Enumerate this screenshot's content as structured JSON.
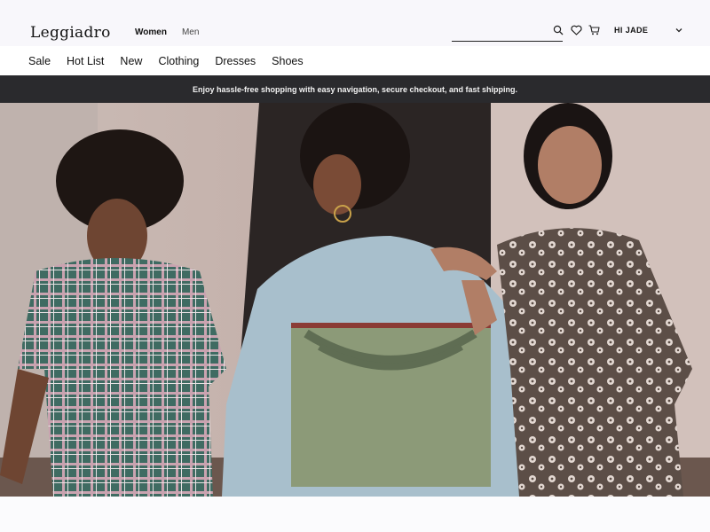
{
  "header": {
    "logo": "Leggiadro",
    "nav": {
      "women": "Women",
      "men": "Men"
    },
    "search": {
      "placeholder": ""
    },
    "account": {
      "label": "HI JADE"
    },
    "icons": [
      "search-icon",
      "heart-icon",
      "cart-icon",
      "chevron-down-icon"
    ]
  },
  "categories": [
    "Sale",
    "Hot List",
    "New",
    "Clothing",
    "Dresses",
    "Shoes"
  ],
  "banner": {
    "text": "Enjoy hassle-free shopping with easy navigation, secure checkout, and fast shipping."
  },
  "colors": {
    "banner_bg": "#2a2a2d",
    "banner_text": "#f3f3f3",
    "header_bg": "#f8f7fb"
  }
}
